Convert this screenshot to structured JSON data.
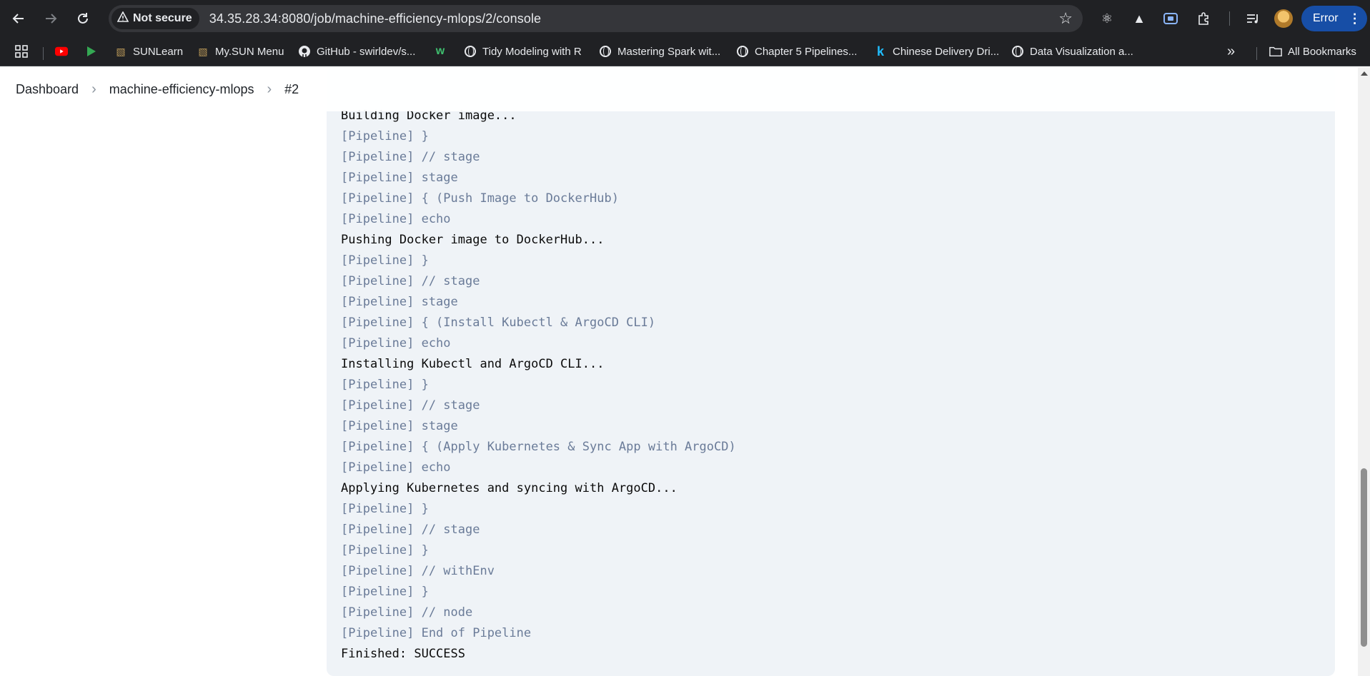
{
  "browser": {
    "security_label": "Not secure",
    "url": "34.35.28.34:8080/job/machine-efficiency-mlops/2/console",
    "profile_status": "Error",
    "bookmarks": [
      {
        "label": ""
      },
      {
        "label": ""
      },
      {
        "label": "SUNLearn"
      },
      {
        "label": "My.SUN Menu"
      },
      {
        "label": "GitHub - swirldev/s..."
      },
      {
        "label": ""
      },
      {
        "label": "Tidy Modeling with R"
      },
      {
        "label": "Mastering Spark wit..."
      },
      {
        "label": "Chapter 5 Pipelines..."
      },
      {
        "label": "Chinese Delivery Dri..."
      },
      {
        "label": "Data Visualization a..."
      }
    ],
    "more_bookmarks": "»",
    "all_bookmarks_label": "All Bookmarks"
  },
  "breadcrumb": {
    "items": [
      "Dashboard",
      "machine-efficiency-mlops",
      "#2"
    ]
  },
  "console": {
    "lines": [
      {
        "text": "Building Docker image...",
        "kind": "out"
      },
      {
        "text": "[Pipeline] }",
        "kind": "pipe"
      },
      {
        "text": "[Pipeline] // stage",
        "kind": "pipe"
      },
      {
        "text": "[Pipeline] stage",
        "kind": "pipe"
      },
      {
        "text": "[Pipeline] { (Push Image to DockerHub)",
        "kind": "pipe"
      },
      {
        "text": "[Pipeline] echo",
        "kind": "pipe"
      },
      {
        "text": "Pushing Docker image to DockerHub...",
        "kind": "out"
      },
      {
        "text": "[Pipeline] }",
        "kind": "pipe"
      },
      {
        "text": "[Pipeline] // stage",
        "kind": "pipe"
      },
      {
        "text": "[Pipeline] stage",
        "kind": "pipe"
      },
      {
        "text": "[Pipeline] { (Install Kubectl & ArgoCD CLI)",
        "kind": "pipe"
      },
      {
        "text": "[Pipeline] echo",
        "kind": "pipe"
      },
      {
        "text": "Installing Kubectl and ArgoCD CLI...",
        "kind": "out"
      },
      {
        "text": "[Pipeline] }",
        "kind": "pipe"
      },
      {
        "text": "[Pipeline] // stage",
        "kind": "pipe"
      },
      {
        "text": "[Pipeline] stage",
        "kind": "pipe"
      },
      {
        "text": "[Pipeline] { (Apply Kubernetes & Sync App with ArgoCD)",
        "kind": "pipe"
      },
      {
        "text": "[Pipeline] echo",
        "kind": "pipe"
      },
      {
        "text": "Applying Kubernetes and syncing with ArgoCD...",
        "kind": "out"
      },
      {
        "text": "[Pipeline] }",
        "kind": "pipe"
      },
      {
        "text": "[Pipeline] // stage",
        "kind": "pipe"
      },
      {
        "text": "[Pipeline] }",
        "kind": "pipe"
      },
      {
        "text": "[Pipeline] // withEnv",
        "kind": "pipe"
      },
      {
        "text": "[Pipeline] }",
        "kind": "pipe"
      },
      {
        "text": "[Pipeline] // node",
        "kind": "pipe"
      },
      {
        "text": "[Pipeline] End of Pipeline",
        "kind": "pipe"
      },
      {
        "text": "Finished: SUCCESS",
        "kind": "out"
      }
    ]
  },
  "colors": {
    "pipeline_text": "#6a7b98",
    "output_text": "#0b0b0b",
    "console_bg": "#eff3f7",
    "error_pill": "#174ea6"
  },
  "icons": [
    "back-arrow-icon",
    "forward-arrow-icon",
    "reload-icon",
    "warning-icon",
    "star-icon",
    "react-devtools-icon",
    "angular-icon",
    "screen-capture-icon",
    "extensions-icon",
    "reading-list-icon",
    "kebab-menu-icon",
    "apps-grid-icon",
    "youtube-icon",
    "play-icon",
    "sunlearn-icon",
    "github-icon",
    "w-icon",
    "globe-icon",
    "kaggle-icon",
    "folder-icon"
  ]
}
